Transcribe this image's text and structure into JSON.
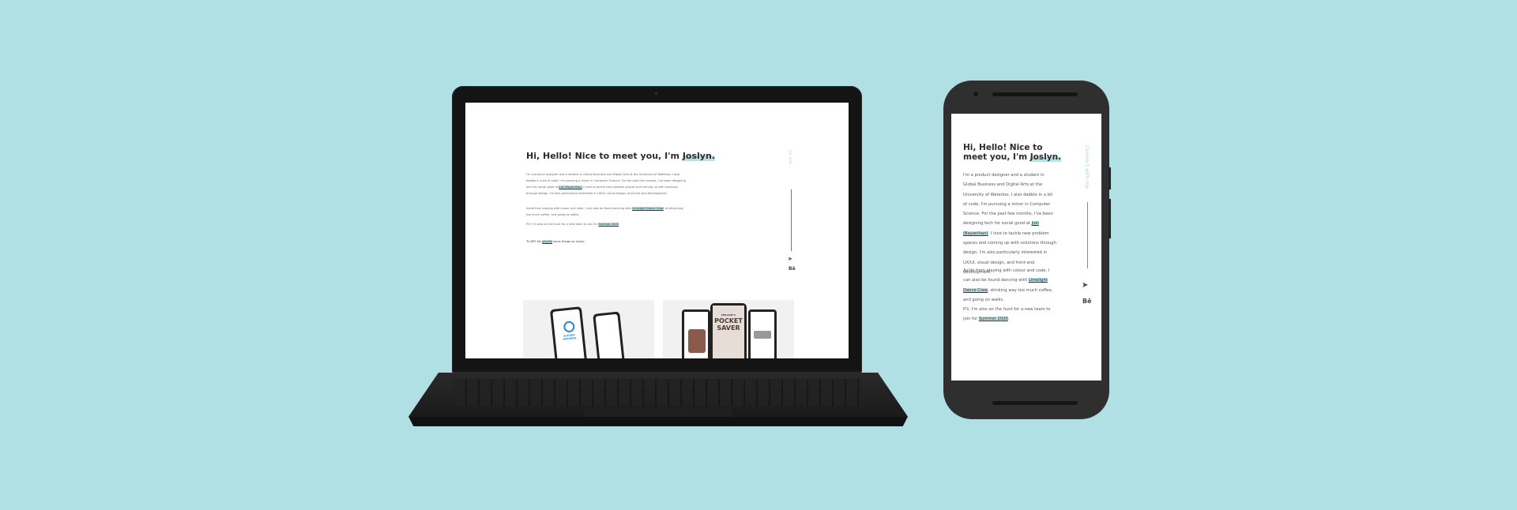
{
  "desktop": {
    "heading_prefix": "Hi, Hello! Nice to meet you, I'm ",
    "heading_name": "Joslyn.",
    "para1": "I'm a product designer and a student in Global Business and Digital Arts at the University of Waterloo. I also dabble in a bit of code. I'm pursuing a minor in Computer Science. For the past few months, I've been designing tech for social good at ",
    "para1_link": "Juki (Bayanihan)",
    "para1_end": " // love to tackle new problem spaces and coming up with solutions through design. I'm also particularly interested in UX/UI, visual design, and front-end development.",
    "para2": "Aside from playing with colour and code, I can also be found dancing with ",
    "para2_link": "Limelight Dance Crew",
    "para2_end": ", drinking way too much coffee, and going on walks.",
    "para3": "P.S. I'm also on the hunt for a new team to join for ",
    "para3_link": "Summer 2020",
    "para3_end": ".",
    "para4": "TL;DR? My ",
    "para4_link": "playlist",
    "para4_end": " sums things up nicely.",
    "side_text": "Say hello",
    "project1_app": "SUSTAIN BUSINESS",
    "project2_line1": "MELANIE'S",
    "project2_line2": "POCKET",
    "project2_line3": "SAVER"
  },
  "mobile": {
    "heading_prefix": "Hi, Hello! Nice to meet you, I'm ",
    "heading_name": "Joslyn.",
    "para1": "I'm a product designer and a student in Global Business and Digital Arts at the University of Waterloo. I also dabble in a bit of code. I'm pursuing a minor in Computer Science. For the past few months, I've been designing tech for social good at ",
    "para1_link": "Juki (Bayanihan)",
    "para1_end": ". I love to tackle new problem spaces and coming up with solutions through design. I'm also particularly interested in UX/UI, visual design, and front-end development.",
    "para2": "Aside from playing with colour and code, I can also be found dancing with ",
    "para2_link": "Limelight Dance Crew",
    "para2_end": ", drinking way too much coffee, and going on walks.",
    "para3": "P.S. I'm also on the hunt for a new team to join for ",
    "para3_link": "Summer 2020",
    "para3_end": ".",
    "side_text": "Connect with me"
  },
  "colors": {
    "background": "#b0dfe4",
    "highlight": "#b7e1e6",
    "device": "#141414"
  },
  "icons": {
    "send": "paper-plane-icon",
    "behance": "behance-icon"
  }
}
